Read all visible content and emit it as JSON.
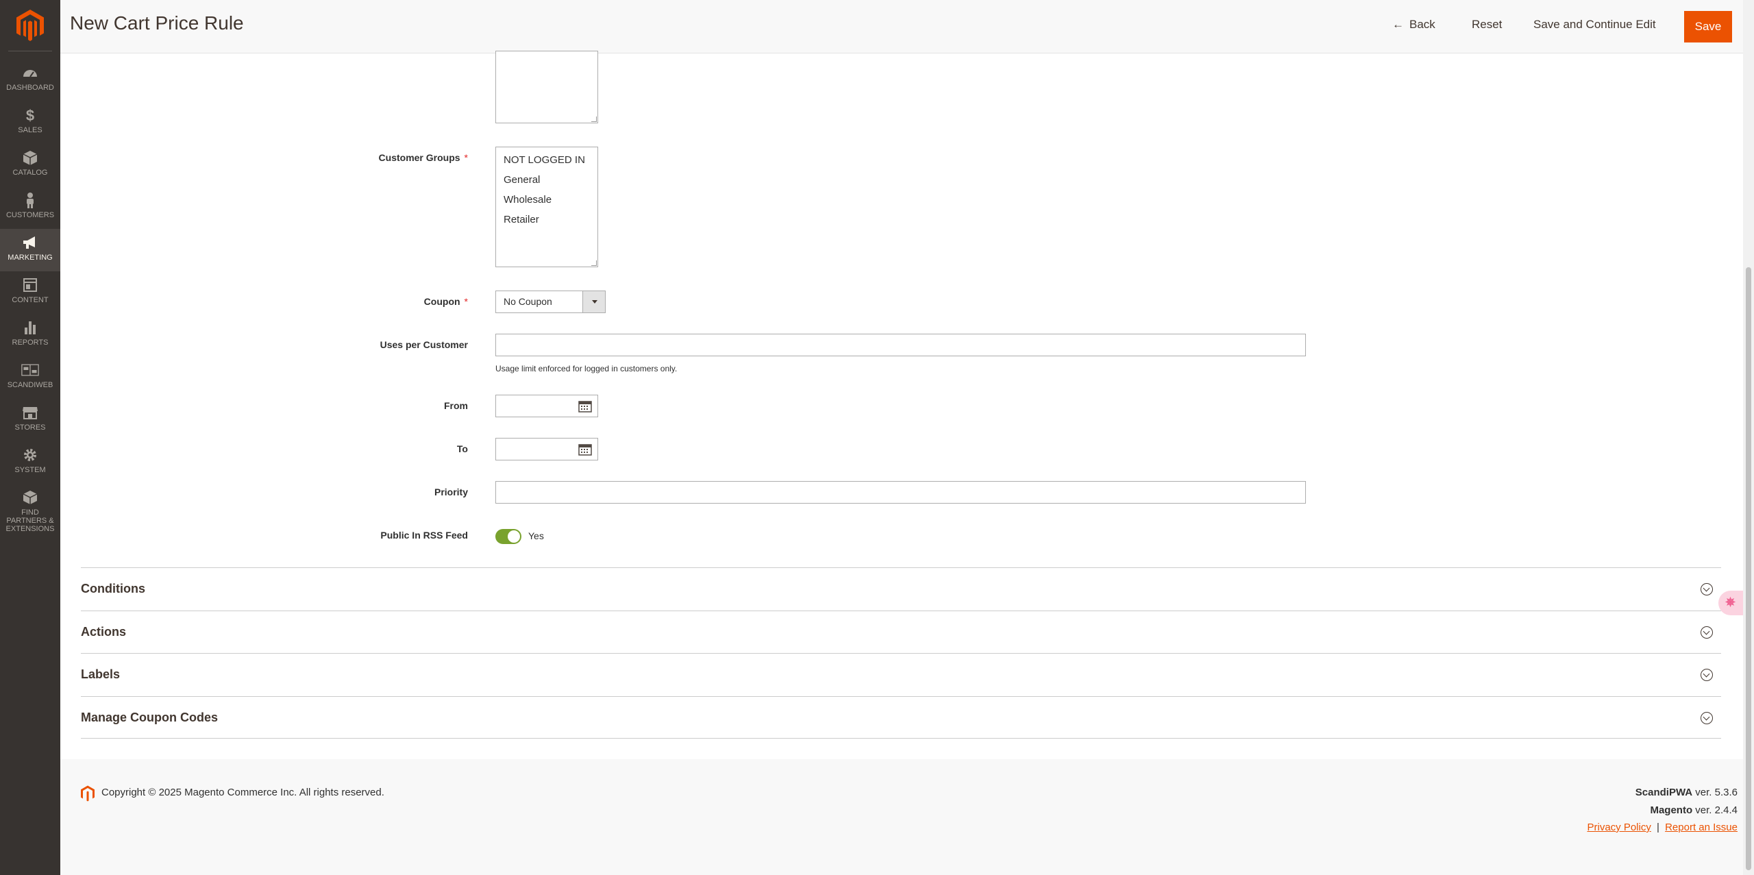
{
  "header": {
    "title": "New Cart Price Rule",
    "back_label": "Back",
    "reset_label": "Reset",
    "save_continue_label": "Save and Continue Edit",
    "save_label": "Save"
  },
  "sidebar": {
    "items": [
      {
        "label": "DASHBOARD",
        "icon": "dashboard-icon"
      },
      {
        "label": "SALES",
        "icon": "dollar-icon"
      },
      {
        "label": "CATALOG",
        "icon": "box-icon"
      },
      {
        "label": "CUSTOMERS",
        "icon": "person-icon"
      },
      {
        "label": "MARKETING",
        "icon": "megaphone-icon"
      },
      {
        "label": "CONTENT",
        "icon": "layout-icon"
      },
      {
        "label": "REPORTS",
        "icon": "bar-chart-icon"
      },
      {
        "label": "SCANDIWEB",
        "icon": "scandiweb-icon"
      },
      {
        "label": "STORES",
        "icon": "store-icon"
      },
      {
        "label": "SYSTEM",
        "icon": "gear-icon"
      },
      {
        "label": "FIND PARTNERS & EXTENSIONS",
        "icon": "cube-icon"
      }
    ]
  },
  "form": {
    "customer_groups": {
      "label": "Customer Groups",
      "options": [
        "NOT LOGGED IN",
        "General",
        "Wholesale",
        "Retailer"
      ]
    },
    "coupon": {
      "label": "Coupon",
      "value": "No Coupon"
    },
    "uses_per_customer": {
      "label": "Uses per Customer",
      "value": "",
      "note": "Usage limit enforced for logged in customers only."
    },
    "from": {
      "label": "From",
      "value": ""
    },
    "to": {
      "label": "To",
      "value": ""
    },
    "priority": {
      "label": "Priority",
      "value": ""
    },
    "rss": {
      "label": "Public In RSS Feed",
      "state_label": "Yes",
      "checked": true
    }
  },
  "sections": [
    {
      "title": "Conditions"
    },
    {
      "title": "Actions"
    },
    {
      "title": "Labels"
    },
    {
      "title": "Manage Coupon Codes"
    }
  ],
  "footer": {
    "copyright": "Copyright © 2025 Magento Commerce Inc. All rights reserved.",
    "scandipwa_name": "ScandiPWA",
    "scandipwa_ver": " ver. 5.3.6",
    "magento_name": "Magento",
    "magento_ver": " ver. 2.4.4",
    "privacy_label": "Privacy Policy",
    "separator": "|",
    "report_label": "Report an Issue"
  },
  "colors": {
    "accent": "#eb5202",
    "sidebar_bg": "#373330",
    "toggle_on": "#79a22e"
  }
}
